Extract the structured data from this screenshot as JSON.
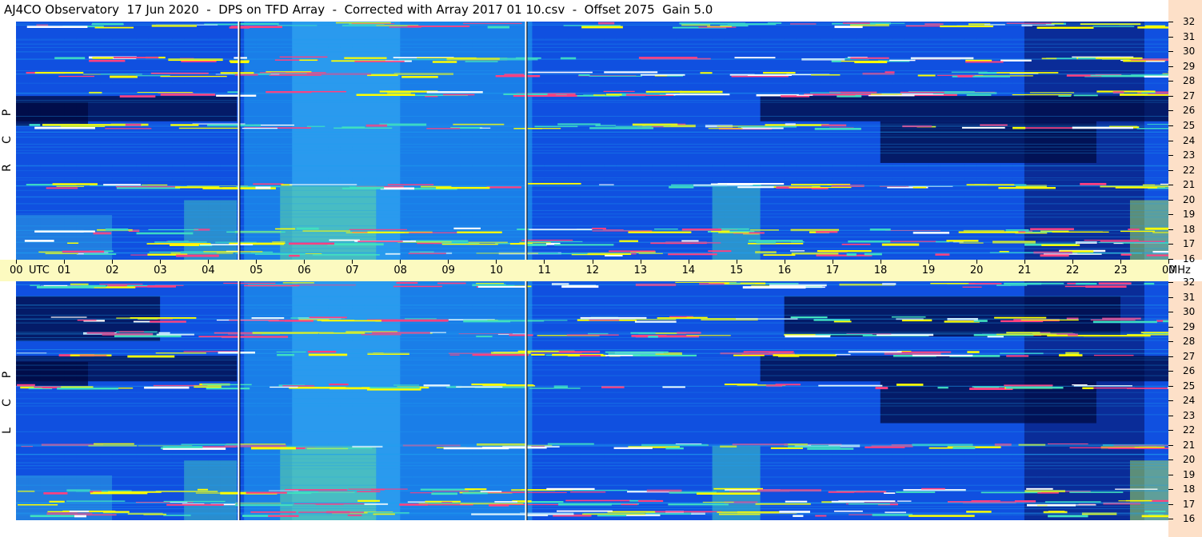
{
  "title": "AJ4CO Observatory  17 Jun 2020  -  DPS on TFD Array  -  Corrected with Array 2017 01 10.csv  -  Offset 2075  Gain 5.0",
  "chart_data": {
    "type": "heatmap",
    "panels": [
      {
        "name": "RCP",
        "label_letters": [
          "R",
          "C",
          "P"
        ]
      },
      {
        "name": "LCP",
        "label_letters": [
          "L",
          "C",
          "P"
        ]
      }
    ],
    "x_axis": {
      "unit_label": "UTC",
      "tick_labels": [
        "00",
        "01",
        "02",
        "03",
        "04",
        "05",
        "06",
        "07",
        "08",
        "09",
        "10",
        "11",
        "12",
        "13",
        "14",
        "15",
        "16",
        "17",
        "18",
        "19",
        "20",
        "21",
        "22",
        "23",
        "00"
      ],
      "range_hours": [
        0,
        24
      ]
    },
    "y_axis": {
      "unit_label": "MHz",
      "tick_labels": [
        "32",
        "31",
        "30",
        "29",
        "28",
        "27",
        "26",
        "25",
        "24",
        "23",
        "22",
        "21",
        "20",
        "19",
        "18",
        "17",
        "16"
      ],
      "range_mhz": [
        16,
        32
      ]
    },
    "colormap": [
      "#000a40",
      "#0020a0",
      "#1050e0",
      "#20a0f0",
      "#40e0c0",
      "#c0f040",
      "#ffff00",
      "#ff4080",
      "#ffffff"
    ],
    "interference_bands_mhz": [
      31.8,
      29.5,
      28.5,
      27.2,
      25.0,
      21.0,
      18.0,
      17.2,
      16.5
    ],
    "dropout_times_utc": [
      4.62,
      10.6
    ]
  }
}
